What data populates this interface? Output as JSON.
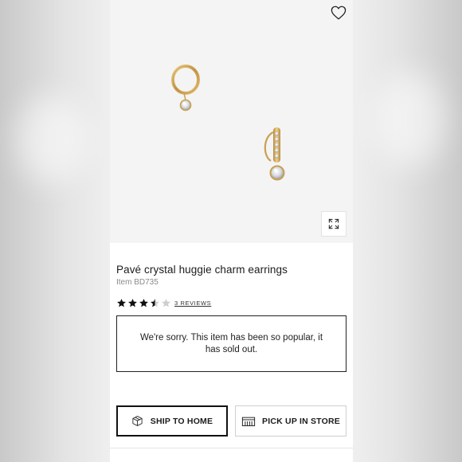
{
  "product": {
    "title": "Pavé crystal huggie charm earrings",
    "item_number": "Item BD735",
    "rating": 3.5,
    "rating_max": 5,
    "reviews_label": "3 REVIEWS"
  },
  "notice": {
    "sold_out_message": "We're sorry. This item has been so popular, it has sold out."
  },
  "actions": {
    "ship_label": "SHIP TO HOME",
    "pickup_label": "PICK UP IN STORE"
  },
  "icons": {
    "favorite": "heart-icon",
    "expand": "expand-icon",
    "ship": "package-icon",
    "pickup": "store-icon"
  },
  "colors": {
    "gold": "#d4a85a",
    "text": "#1b1b1b",
    "muted": "#8a8a8a",
    "image_bg": "#f4f4f4"
  }
}
